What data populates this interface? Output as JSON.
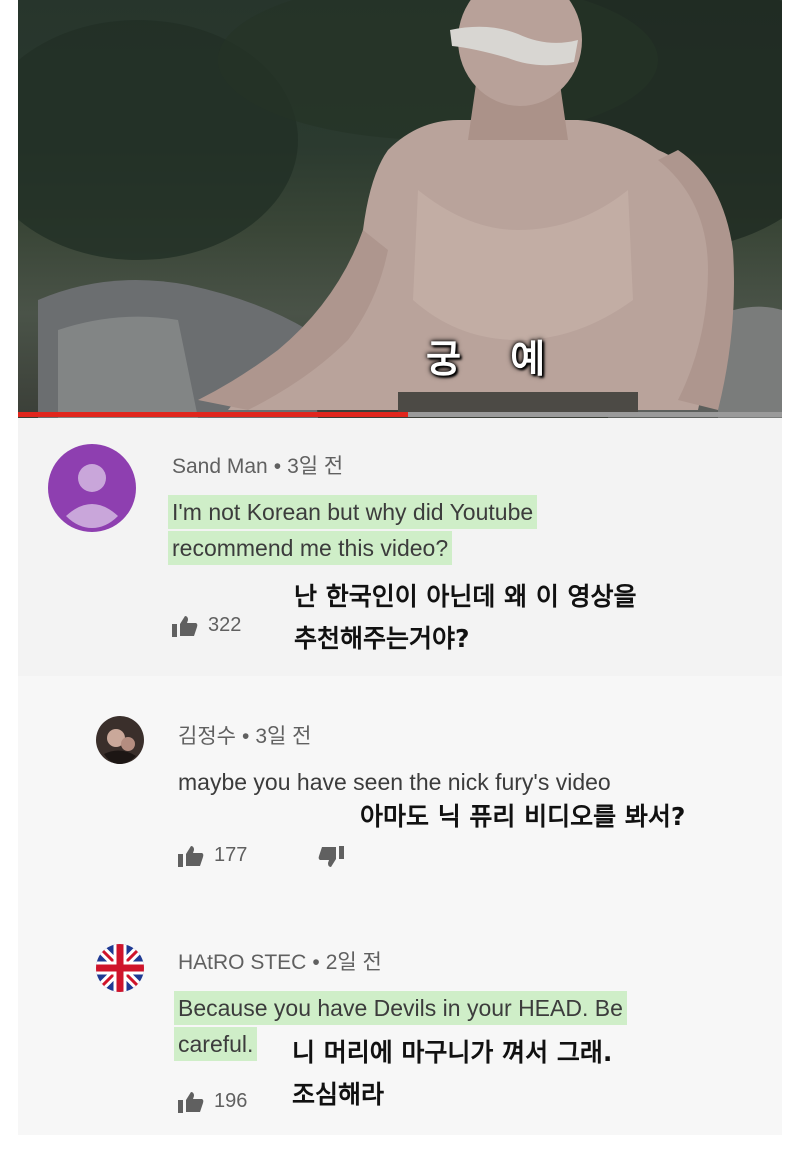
{
  "video": {
    "subtitle": "궁 예",
    "progress_fraction": 0.51
  },
  "comments": [
    {
      "author": "Sand Man",
      "time": "3일 전",
      "text_lines": [
        "I'm not Korean but why did Youtube",
        "recommend me this video?"
      ],
      "likes": "322",
      "translation_lines": [
        "난 한국인이 아닌데 왜 이 영상을",
        "추천해주는거야?"
      ],
      "avatar_color": "#8e3fb0"
    },
    {
      "author": "김정수",
      "time": "3일 전",
      "text_lines": [
        "maybe you have seen the nick fury's video"
      ],
      "likes": "177",
      "translation_lines": [
        "아마도 닉 퓨리 비디오를 봐서?"
      ]
    },
    {
      "author": "HAtRO STEC",
      "time": "2일 전",
      "text_lines": [
        "Because you have Devils in your HEAD. Be",
        "careful."
      ],
      "likes": "196",
      "translation_lines": [
        "니 머리에 마구니가 껴서 그래.",
        "조심해라"
      ]
    }
  ],
  "colors": {
    "highlight": "#cfeec8",
    "progress": "#e0261d",
    "avatar_purple": "#8e3fb0"
  },
  "icons": [
    "user-avatar-icon",
    "thumbs-up-icon",
    "thumbs-down-icon",
    "union-jack-flag-icon"
  ]
}
